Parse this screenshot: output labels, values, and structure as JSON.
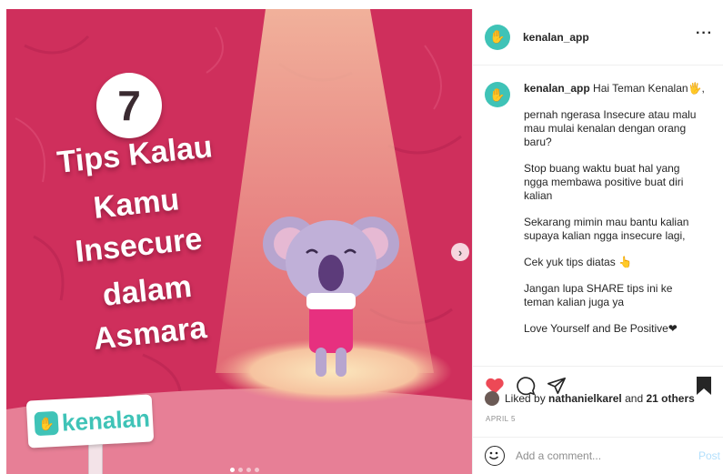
{
  "media": {
    "number": "7",
    "title_lines": [
      "Tips Kalau",
      "Kamu",
      "Insecure",
      "dalam",
      "Asmara"
    ],
    "brand": "kenalan",
    "slide_count": 4,
    "active_slide": 1,
    "next_icon": "chevron-right-icon"
  },
  "header": {
    "username": "kenalan_app",
    "more_label": "···"
  },
  "caption": {
    "username": "kenalan_app",
    "first_line": "Hai Teman Kenalan🖐,",
    "paragraphs": [
      "pernah ngerasa Insecure atau malu mau mulai kenalan dengan orang baru?",
      "Stop buang waktu buat hal yang ngga membawa positive buat diri kalian",
      "Sekarang mimin mau bantu kalian supaya kalian ngga insecure lagi,",
      "Cek yuk tips diatas 👆",
      "Jangan lupa SHARE tips ini ke teman kalian juga ya",
      "Love Yourself and Be Positive❤"
    ]
  },
  "actions": {
    "like_icon": "heart-icon",
    "comment_icon": "comment-icon",
    "share_icon": "paper-plane-icon",
    "save_icon": "bookmark-icon"
  },
  "likes": {
    "prefix": "Liked by",
    "user": "nathanielkarel",
    "mid": "and",
    "others": "21 others"
  },
  "date": "APRIL 5",
  "comment": {
    "placeholder": "Add a comment...",
    "post_label": "Post"
  },
  "colors": {
    "brand_teal": "#3fc3b7",
    "media_pink": "#d3325f",
    "like_red": "#ed4956"
  }
}
